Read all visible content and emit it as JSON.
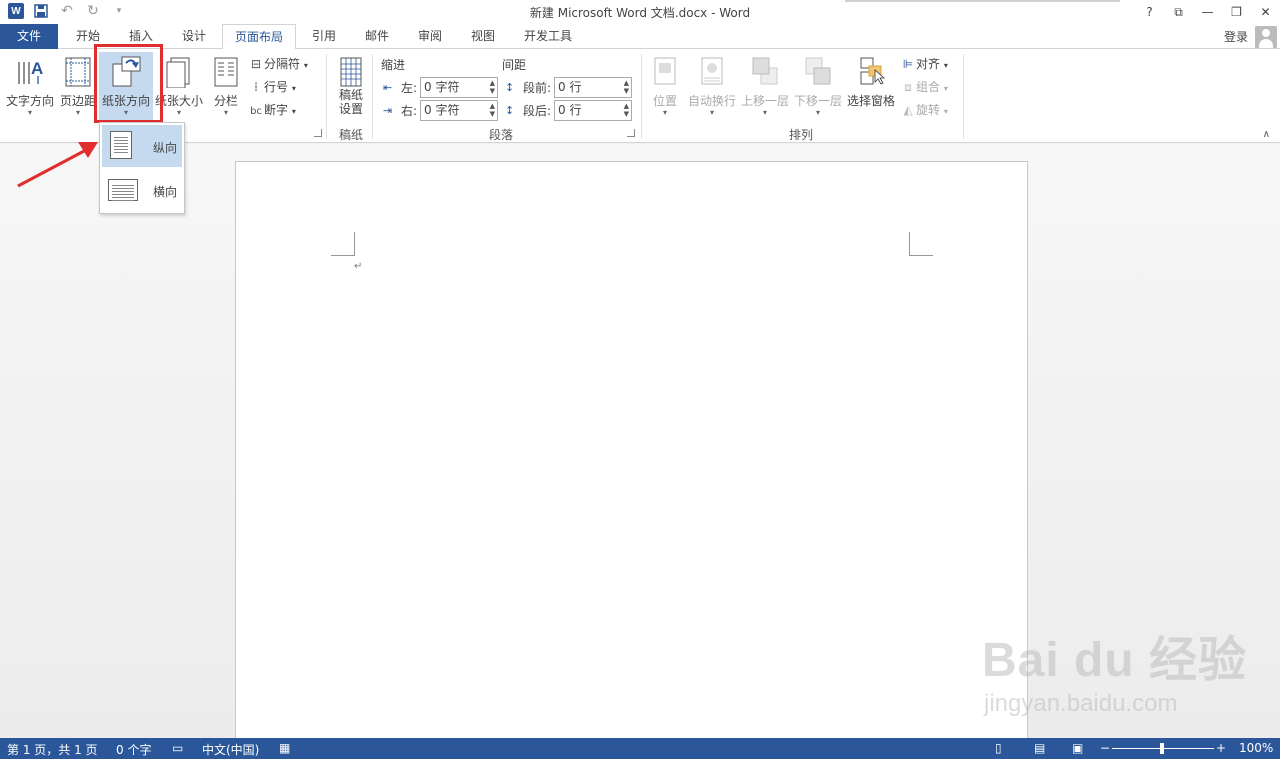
{
  "titlebar": {
    "title": "新建 Microsoft Word 文档.docx - Word",
    "logo": "W",
    "qat_icons": [
      "word-logo-icon",
      "save-icon",
      "undo-icon",
      "redo-icon",
      "customize-qat-icon"
    ],
    "win_help": "?",
    "win_ribbon": "⧉",
    "win_min": "—",
    "win_restore": "❐",
    "win_close": "✕"
  },
  "tabs": {
    "file": "文件",
    "home": "开始",
    "insert": "插入",
    "design": "设计",
    "layout": "页面布局",
    "references": "引用",
    "mailings": "邮件",
    "review": "审阅",
    "view": "视图",
    "developer": "开发工具",
    "signin": "登录"
  },
  "ribbon": {
    "page_setup": {
      "text_direction": "文字方向",
      "margins": "页边距",
      "orientation": "纸张方向",
      "size": "纸张大小",
      "columns": "分栏",
      "breaks": "分隔符",
      "line_numbers": "行号",
      "hyphenation": "断字"
    },
    "manuscript": {
      "setup_line1": "稿纸",
      "setup_line2": "设置",
      "label": "稿纸"
    },
    "paragraph": {
      "indent_head": "缩进",
      "spacing_head": "间距",
      "left_label": "左:",
      "right_label": "右:",
      "before_label": "段前:",
      "after_label": "段后:",
      "left_value": "0 字符",
      "right_value": "0 字符",
      "before_value": "0 行",
      "after_value": "0 行",
      "label": "段落"
    },
    "arrange": {
      "position": "位置",
      "wrap_text": "自动换行",
      "bring_forward": "上移一层",
      "send_backward": "下移一层",
      "selection_pane": "选择窗格",
      "align": "对齐",
      "group": "组合",
      "rotate": "旋转",
      "label": "排列"
    }
  },
  "orientation_menu": {
    "portrait": "纵向",
    "landscape": "横向",
    "selected": "纵向"
  },
  "document": {
    "paragraph_mark": "↵"
  },
  "watermark": {
    "main": "Bai du 经验",
    "sub": "jingyan.baidu.com"
  },
  "statusbar": {
    "page": "第 1 页，共 1 页",
    "words": "0 个字",
    "language": "中文(中国)",
    "zoom": "100%",
    "zoom_minus": "−",
    "zoom_plus": "+"
  },
  "colors": {
    "accent": "#2b579a",
    "highlight_red": "#e02d2d",
    "selected_bg": "#c5d9ef"
  }
}
